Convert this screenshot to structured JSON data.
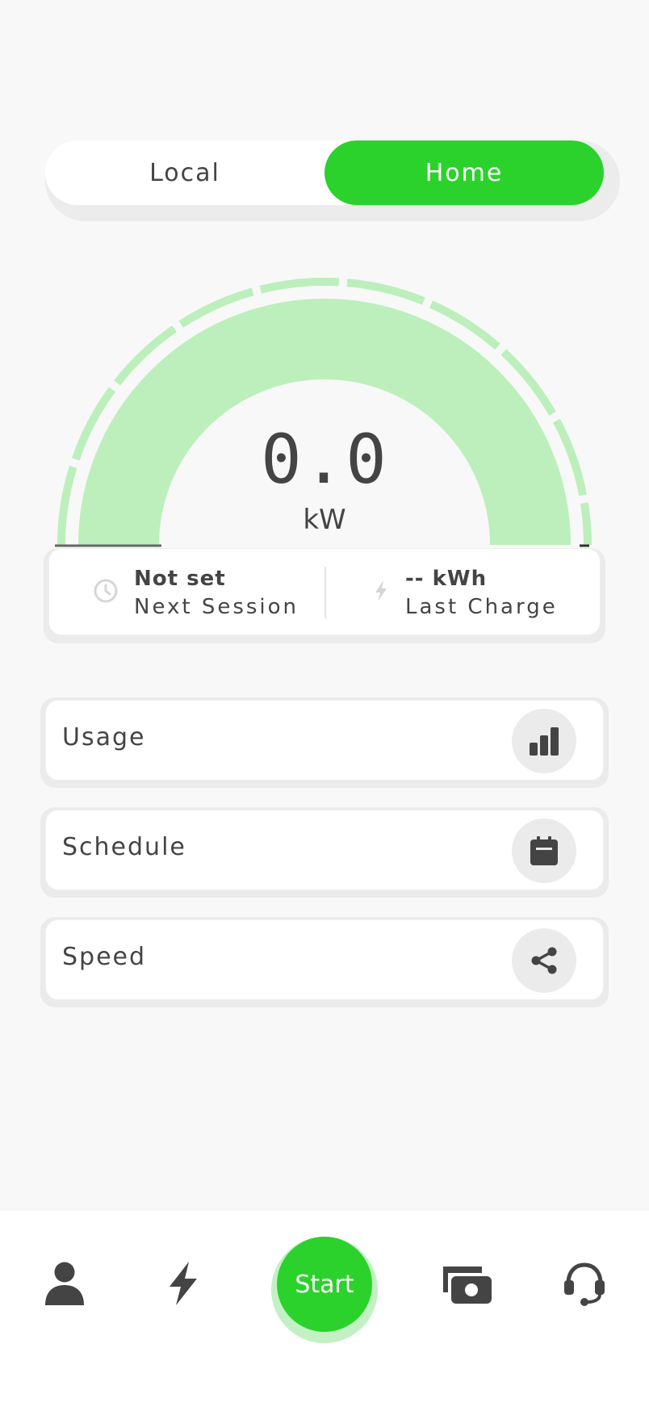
{
  "mode_toggle": {
    "local_label": "Local",
    "home_label": "Home",
    "selected": "Home"
  },
  "gauge": {
    "value": "0.0",
    "unit": "kW",
    "fill_fraction": 0
  },
  "info": {
    "next_session": {
      "value": "Not set",
      "label": "Next Session",
      "icon": "clock-icon"
    },
    "last_charge": {
      "value": "-- kWh",
      "label": "Last Charge",
      "icon": "bolt-icon"
    }
  },
  "menu": {
    "items": [
      {
        "label": "Usage",
        "icon": "bar-chart-icon"
      },
      {
        "label": "Schedule",
        "icon": "calendar-icon"
      },
      {
        "label": "Speed",
        "icon": "share-icon"
      }
    ]
  },
  "bottom_nav": {
    "start_label": "Start",
    "items": [
      "profile-icon",
      "bolt-icon",
      "start-button",
      "wallet-icon",
      "headset-icon"
    ]
  },
  "colors": {
    "accent": "#2bd22b",
    "gauge_fill": "#bcefbc",
    "text": "#444444",
    "background": "#f8f8f8"
  }
}
